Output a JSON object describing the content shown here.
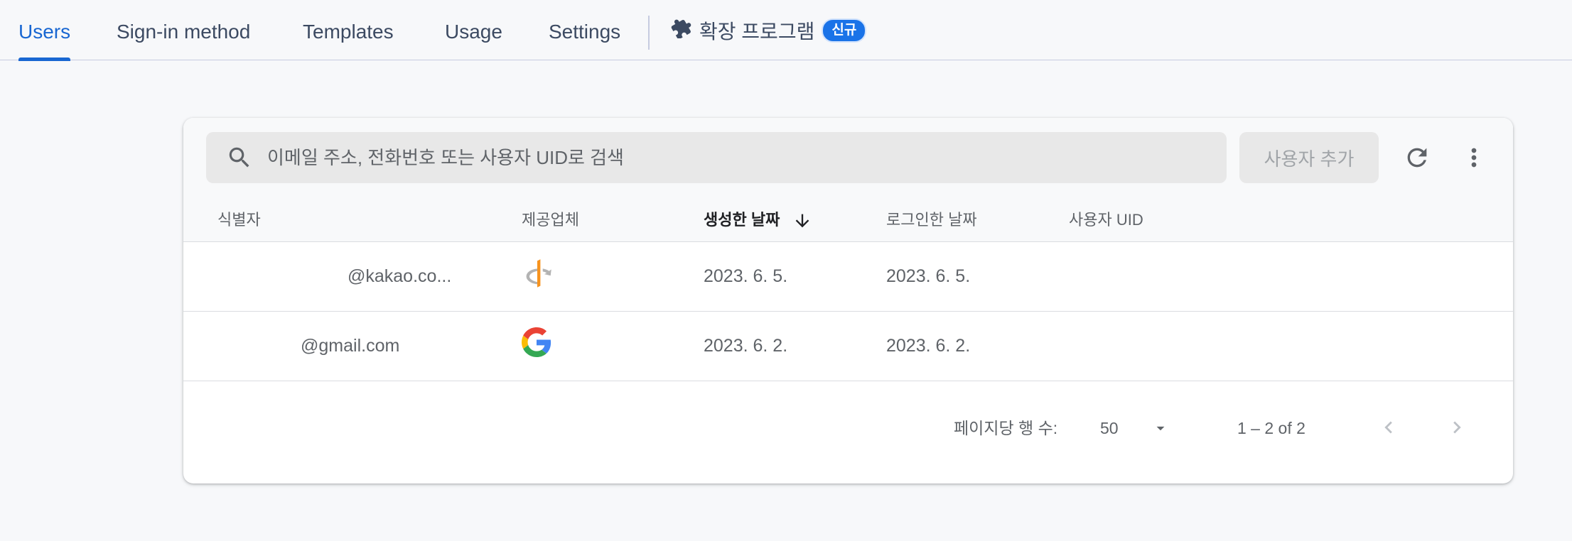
{
  "tabs": [
    {
      "label": "Users",
      "active": true
    },
    {
      "label": "Sign-in method",
      "active": false
    },
    {
      "label": "Templates",
      "active": false
    },
    {
      "label": "Usage",
      "active": false
    },
    {
      "label": "Settings",
      "active": false
    }
  ],
  "extensions_tab": {
    "label": "확장 프로그램",
    "badge": "신규",
    "icon": "puzzle-icon"
  },
  "search": {
    "placeholder": "이메일 주소, 전화번호 또는 사용자 UID로 검색",
    "icon": "search-icon"
  },
  "toolbar": {
    "add_user_label": "사용자 추가",
    "refresh_icon": "refresh-icon",
    "more_icon": "more-vert-icon"
  },
  "table": {
    "columns": [
      "식별자",
      "제공업체",
      "생성한 날짜",
      "로그인한 날짜",
      "사용자 UID"
    ],
    "sorted_column": "생성한 날짜",
    "sort_icon": "arrow-down-icon",
    "rows": [
      {
        "identifier": "@kakao.co...",
        "provider": "openid-icon",
        "created": "2023. 6. 5.",
        "signed_in": "2023. 6. 5.",
        "uid": ""
      },
      {
        "identifier": "@gmail.com",
        "provider": "google-icon",
        "created": "2023. 6. 2.",
        "signed_in": "2023. 6. 2.",
        "uid": ""
      }
    ]
  },
  "pagination": {
    "rows_per_page_label": "페이지당 행 수:",
    "rows_per_page_value": "50",
    "range": "1 – 2 of 2"
  },
  "colors": {
    "accent": "#1967d2",
    "badge": "#1a73e8",
    "background": "#f7f8fa"
  }
}
